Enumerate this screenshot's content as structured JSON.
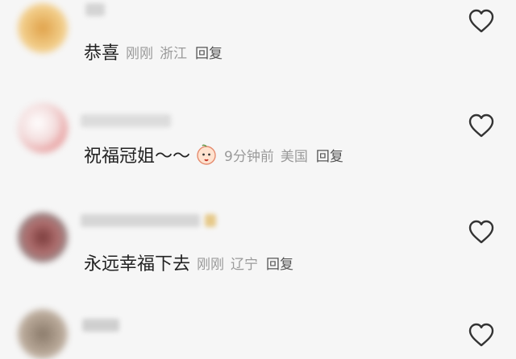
{
  "comments": [
    {
      "text": "恭喜",
      "time": "刚刚",
      "location": "浙江",
      "reply": "回复",
      "icon": "heart-outline-icon"
    },
    {
      "text": "祝福冠姐～～",
      "time": "9分钟前",
      "location": "美国",
      "reply": "回复",
      "icon": "heart-outline-icon",
      "emoji": "peach-emoji"
    },
    {
      "text": "永远幸福下去",
      "time": "刚刚",
      "location": "辽宁",
      "reply": "回复",
      "icon": "heart-outline-icon"
    },
    {
      "text": "",
      "time": "",
      "location": "",
      "reply": "",
      "icon": "heart-outline-icon"
    }
  ],
  "colors": {
    "text": "#222222",
    "meta": "#9a9a9a",
    "reply": "#555555",
    "background": "#f6f6f6"
  }
}
